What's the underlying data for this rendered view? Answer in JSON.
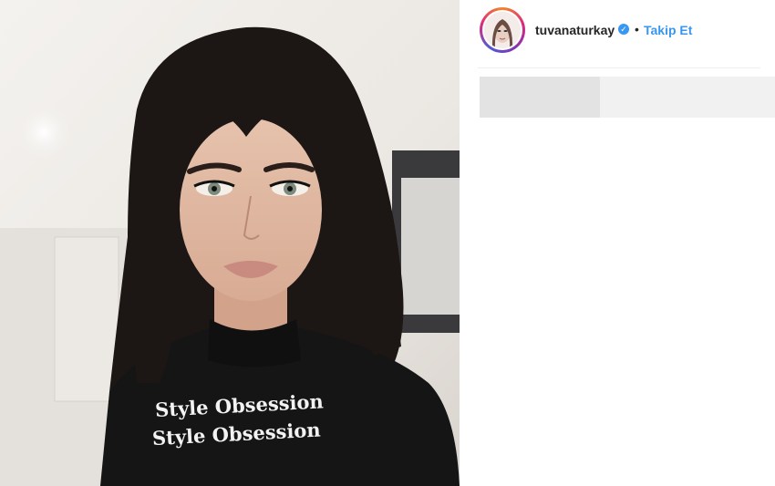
{
  "post": {
    "image_alt": "selfie photo",
    "shirt_text_line1": "Style Obsession",
    "shirt_text_line2": "Style Obsession"
  },
  "profile": {
    "username": "tuvanaturkay",
    "verified_icon": "verified-badge-icon",
    "separator": "•",
    "follow_label": "Takip Et"
  },
  "colors": {
    "link": "#3897f0",
    "text": "#262626",
    "ring": [
      "#f58529",
      "#dd2a7b",
      "#8134af"
    ]
  }
}
